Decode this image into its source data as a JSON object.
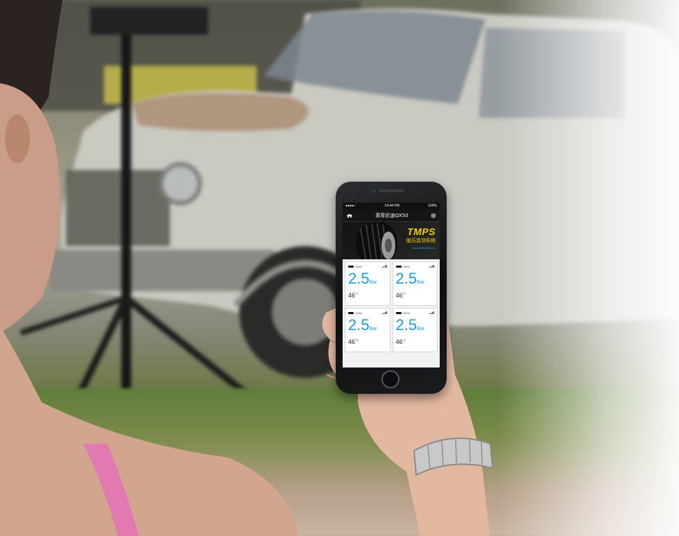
{
  "phone_app": {
    "status": {
      "carrier": "●●●●○",
      "time": "14:44 PM",
      "battery": "100%"
    },
    "header": {
      "title": "英菲尼迪QX50"
    },
    "banner": {
      "brand": "TMPS",
      "subtitle": "胎压监测系统",
      "url": "www.tlstar168.com"
    },
    "tires": [
      {
        "battery": "100%",
        "pressure": "2.5",
        "unit": "Bar",
        "temperature": "46",
        "temp_unit": "°C"
      },
      {
        "battery": "100%",
        "pressure": "2.5",
        "unit": "Bar",
        "temperature": "46",
        "temp_unit": "°C"
      },
      {
        "battery": "100%",
        "pressure": "2.5",
        "unit": "Bar",
        "temperature": "46",
        "temp_unit": "°C"
      },
      {
        "battery": "100%",
        "pressure": "2.5",
        "unit": "Bar",
        "temperature": "46",
        "temp_unit": "°C"
      }
    ]
  },
  "icons": [
    "car-icon",
    "gear-icon",
    "battery-icon",
    "signal-icon"
  ],
  "colors": {
    "accent_blue": "#1d9be0",
    "brand_yellow": "#f5d000",
    "screen_bg": "#f2f2f2",
    "appbar_bg": "#151515"
  }
}
